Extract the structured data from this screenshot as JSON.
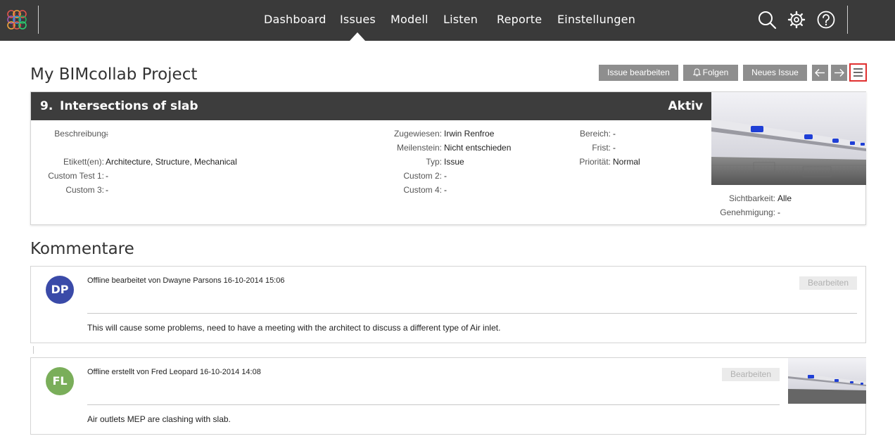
{
  "nav": {
    "items": [
      "Dashboard",
      "Issues",
      "Modell",
      "Listen",
      "Reporte",
      "Einstellungen"
    ],
    "active": "Issues",
    "icons": [
      "search-icon",
      "gear-icon",
      "help-icon"
    ]
  },
  "project": {
    "title": "My BIMcollab Project"
  },
  "toolbar": {
    "edit_issue": "Issue bearbeiten",
    "follow": "Folgen",
    "new_issue": "Neues Issue"
  },
  "issue": {
    "number": "9.",
    "title": "Intersections of slab",
    "status": "Aktiv",
    "fields": {
      "beschreibung": {
        "label": "Beschreibung:",
        "value": "-"
      },
      "etiketten": {
        "label": "Etikett(en):",
        "value": "Architecture, Structure, Mechanical"
      },
      "custom1": {
        "label": "Custom Test 1:",
        "value": "-"
      },
      "custom3": {
        "label": "Custom 3:",
        "value": "-"
      },
      "zugewiesen": {
        "label": "Zugewiesen:",
        "value": "Irwin Renfroe"
      },
      "meilenstein": {
        "label": "Meilenstein:",
        "value": "Nicht entschieden"
      },
      "typ": {
        "label": "Typ:",
        "value": "Issue"
      },
      "custom2": {
        "label": "Custom 2:",
        "value": "-"
      },
      "custom4": {
        "label": "Custom 4:",
        "value": "-"
      },
      "bereich": {
        "label": "Bereich:",
        "value": "-"
      },
      "frist": {
        "label": "Frist:",
        "value": "-"
      },
      "prioritaet": {
        "label": "Priorität:",
        "value": "Normal"
      },
      "sichtbarkeit": {
        "label": "Sichtbarkeit:",
        "value": "Alle"
      },
      "genehmigung": {
        "label": "Genehmigung:",
        "value": "-"
      }
    }
  },
  "comments": {
    "title": "Kommentare",
    "items": [
      {
        "initials": "DP",
        "avatar_color": "#3a4aa8",
        "meta": "Offline bearbeitet von Dwayne Parsons 16-10-2014 15:06",
        "edit_label": "Bearbeiten",
        "text": "This will cause some problems, need to have a meeting with the architect to discuss a different type of Air inlet."
      },
      {
        "initials": "FL",
        "avatar_color": "#7aae5a",
        "meta": "Offline erstellt von Fred Leopard 16-10-2014 14:08",
        "edit_label": "Bearbeiten",
        "text": "Air outlets MEP are clashing with slab."
      }
    ]
  },
  "colors": {
    "topbar": "#3a3a3a",
    "issue_header": "#3d3d3d",
    "button": "#8e8e8e",
    "highlight": "#e03030"
  }
}
